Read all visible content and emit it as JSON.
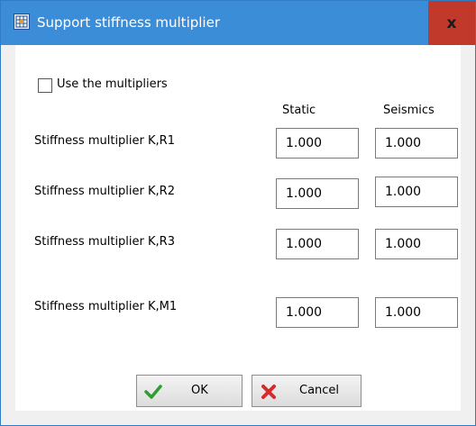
{
  "window": {
    "title": "Support stiffness multiplier",
    "close_label": "x"
  },
  "options": {
    "use_multipliers_label": "Use the multipliers",
    "use_multipliers_checked": false
  },
  "columns": {
    "static": "Static",
    "seismics": "Seismics"
  },
  "rows": [
    {
      "label": "Stiffness multiplier K,R1",
      "static": "1.000",
      "seismics": "1.000"
    },
    {
      "label": "Stiffness multiplier K,R2",
      "static": "1.000",
      "seismics": "1.000"
    },
    {
      "label": "Stiffness multiplier K,R3",
      "static": "1.000",
      "seismics": "1.000"
    },
    {
      "label": "Stiffness multiplier K,M1",
      "static": "1.000",
      "seismics": "1.000"
    }
  ],
  "buttons": {
    "ok_label": "OK",
    "cancel_label": "Cancel"
  },
  "icons": {
    "app": "app-grid-icon",
    "ok": "green-check-icon",
    "cancel": "red-x-icon"
  },
  "colors": {
    "titlebar": "#3c8dd7",
    "close": "#c0392b"
  }
}
